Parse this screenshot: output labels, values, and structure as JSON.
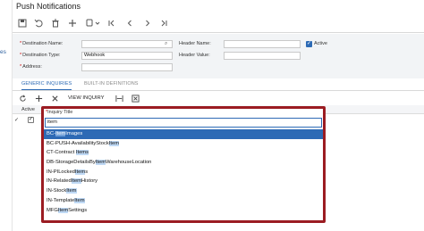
{
  "left_rail": {
    "fragment": "es"
  },
  "page": {
    "title": "Push Notifications"
  },
  "toolbar": {
    "buttons": [
      "save-icon",
      "undo-icon",
      "delete-icon",
      "add-icon",
      "copy-paste-icon",
      "first-icon",
      "previous-icon",
      "next-icon",
      "last-icon"
    ]
  },
  "form": {
    "destination_name": {
      "label": "Destination Name:",
      "value": ""
    },
    "destination_type": {
      "label": "Destination Type:",
      "value": "Webhook"
    },
    "address": {
      "label": "Address:",
      "value": ""
    },
    "header_name": {
      "label": "Header Name:",
      "value": ""
    },
    "header_value": {
      "label": "Header Value:",
      "value": ""
    },
    "active": {
      "label": "Active",
      "checked": true
    }
  },
  "tabs": [
    {
      "label": "GENERIC INQUIRIES",
      "active": true
    },
    {
      "label": "BUILT-IN DEFINITIONS",
      "active": false
    }
  ],
  "grid_toolbar": {
    "view_inquiry": "VIEW INQUIRY"
  },
  "grid": {
    "columns": [
      "Active",
      "Inquiry Title"
    ],
    "rows": [
      {
        "indicator": "✓",
        "active": true
      }
    ]
  },
  "dropdown": {
    "header": "Inquiry Title",
    "query": "item",
    "items": [
      {
        "pre": "BC-",
        "match": "Item",
        "post": "Images",
        "selected": true
      },
      {
        "pre": "BC-PUSH-AvailabilityStock",
        "match": "Item",
        "post": "",
        "selected": false
      },
      {
        "pre": "CT-Contract ",
        "match": "Items",
        "post": "",
        "selected": false
      },
      {
        "pre": "DB-StorageDetailsBy",
        "match": "Item",
        "post": "WarehouseLocation",
        "selected": false
      },
      {
        "pre": "IN-PILocked",
        "match": "Item",
        "post": "s",
        "selected": false
      },
      {
        "pre": "IN-Related",
        "match": "Item",
        "post": "History",
        "selected": false
      },
      {
        "pre": "IN-Stock",
        "match": "Item",
        "post": "",
        "selected": false
      },
      {
        "pre": "IN-Template",
        "match": "Item",
        "post": "",
        "selected": false
      },
      {
        "pre": "MFG",
        "match": "Item",
        "post": "Settings",
        "selected": false
      }
    ]
  }
}
